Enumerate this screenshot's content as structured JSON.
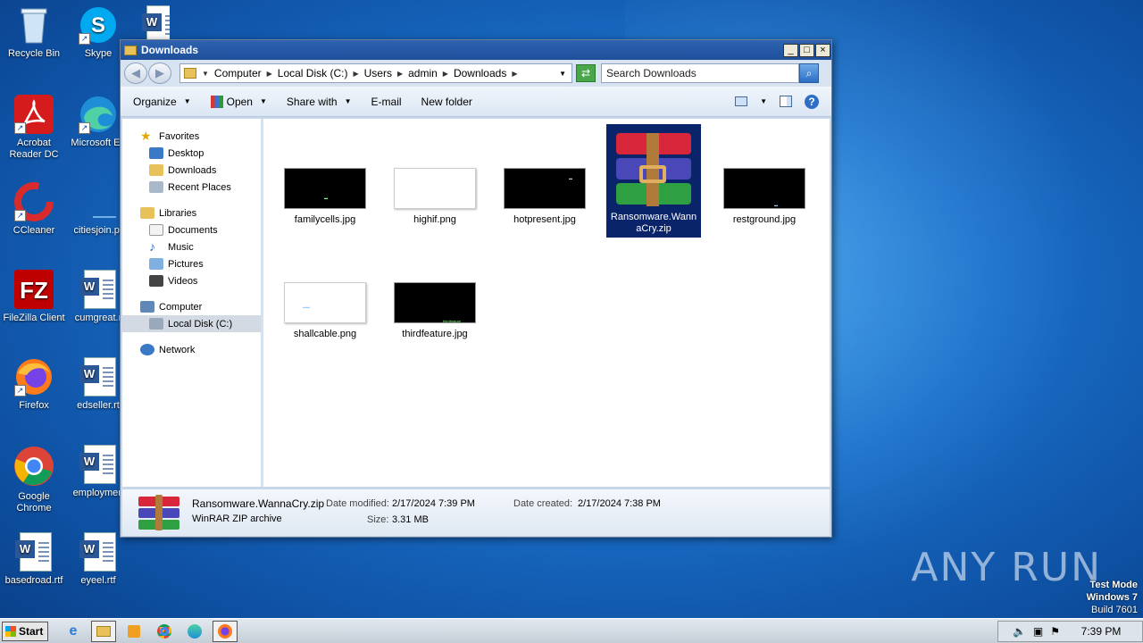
{
  "desktop": {
    "icons": [
      {
        "label": "Recycle Bin",
        "icon": "recycle-bin-icon"
      },
      {
        "label": "Skype",
        "icon": "skype-icon"
      },
      {
        "label": "Acrobat Reader DC",
        "icon": "acrobat-icon"
      },
      {
        "label": "Microsoft Ed",
        "icon": "edge-icon"
      },
      {
        "label": "CCleaner",
        "icon": "ccleaner-icon"
      },
      {
        "label": "citiesjoin.pr",
        "icon": "document-icon"
      },
      {
        "label": "FileZilla Client",
        "icon": "filezilla-icon"
      },
      {
        "label": "cumgreat.r",
        "icon": "word-icon"
      },
      {
        "label": "Firefox",
        "icon": "firefox-icon"
      },
      {
        "label": "edseller.rt",
        "icon": "word-icon"
      },
      {
        "label": "Google Chrome",
        "icon": "chrome-icon"
      },
      {
        "label": "employmen",
        "icon": "word-icon"
      },
      {
        "label": "basedroad.rtf",
        "icon": "word-icon"
      },
      {
        "label": "eyeel.rtf",
        "icon": "word-icon"
      }
    ]
  },
  "window": {
    "title": "Downloads",
    "controls": {
      "minimize": "_",
      "maximize": "□",
      "close": "×"
    },
    "address": {
      "crumbs": [
        "Computer",
        "Local Disk (C:)",
        "Users",
        "admin",
        "Downloads"
      ]
    },
    "search": {
      "placeholder": "Search Downloads"
    },
    "toolbar": {
      "organize": "Organize",
      "open": "Open",
      "share_with": "Share with",
      "email": "E-mail",
      "new_folder": "New folder"
    },
    "navpane": {
      "favorites": "Favorites",
      "desktop": "Desktop",
      "downloads": "Downloads",
      "recent_places": "Recent Places",
      "libraries": "Libraries",
      "documents": "Documents",
      "music": "Music",
      "pictures": "Pictures",
      "videos": "Videos",
      "computer": "Computer",
      "local_disk": "Local Disk (C:)",
      "network": "Network"
    },
    "files": [
      {
        "name": "familycells.jpg",
        "thumb": "black"
      },
      {
        "name": "highif.png",
        "thumb": "white"
      },
      {
        "name": "hotpresent.jpg",
        "thumb": "black"
      },
      {
        "name": "Ransomware.WannaCry.zip",
        "thumb": "rar",
        "selected": true
      },
      {
        "name": "restground.jpg",
        "thumb": "black"
      },
      {
        "name": "shallcable.png",
        "thumb": "white"
      },
      {
        "name": "thirdfeature.jpg",
        "thumb": "black"
      }
    ],
    "details": {
      "filename": "Ransomware.WannaCry.zip",
      "type": "WinRAR ZIP archive",
      "date_modified_label": "Date modified:",
      "date_modified": "2/17/2024 7:39 PM",
      "size_label": "Size:",
      "size": "3.31 MB",
      "date_created_label": "Date created:",
      "date_created": "2/17/2024 7:38 PM"
    }
  },
  "taskbar": {
    "start_label": "Start",
    "clock": "7:39 PM"
  },
  "watermark": "ANY RUN",
  "test_mode": {
    "line1": "Test Mode",
    "line2": "Windows 7",
    "line3": "Build 7601"
  }
}
